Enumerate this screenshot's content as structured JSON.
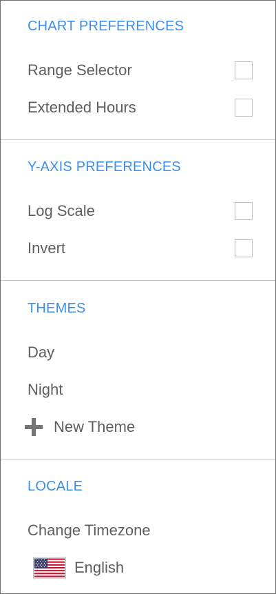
{
  "sections": [
    {
      "title": "CHART PREFERENCES",
      "items": [
        {
          "label": "Range Selector",
          "checked": false
        },
        {
          "label": "Extended Hours",
          "checked": false
        }
      ]
    },
    {
      "title": "Y-AXIS PREFERENCES",
      "items": [
        {
          "label": "Log Scale",
          "checked": false
        },
        {
          "label": "Invert",
          "checked": false
        }
      ]
    },
    {
      "title": "THEMES",
      "items": [
        {
          "label": "Day"
        },
        {
          "label": "Night"
        },
        {
          "label": "New Theme",
          "icon": "plus-icon"
        }
      ]
    },
    {
      "title": "LOCALE",
      "items": [
        {
          "label": "Change Timezone"
        },
        {
          "label": "English",
          "icon": "us-flag-icon"
        }
      ]
    }
  ],
  "colors": {
    "accent": "#3b8fe8",
    "text": "#5e5e5e",
    "divider": "#c9c9c9",
    "checkbox_border": "#bdbdbd",
    "icon": "#757575"
  }
}
